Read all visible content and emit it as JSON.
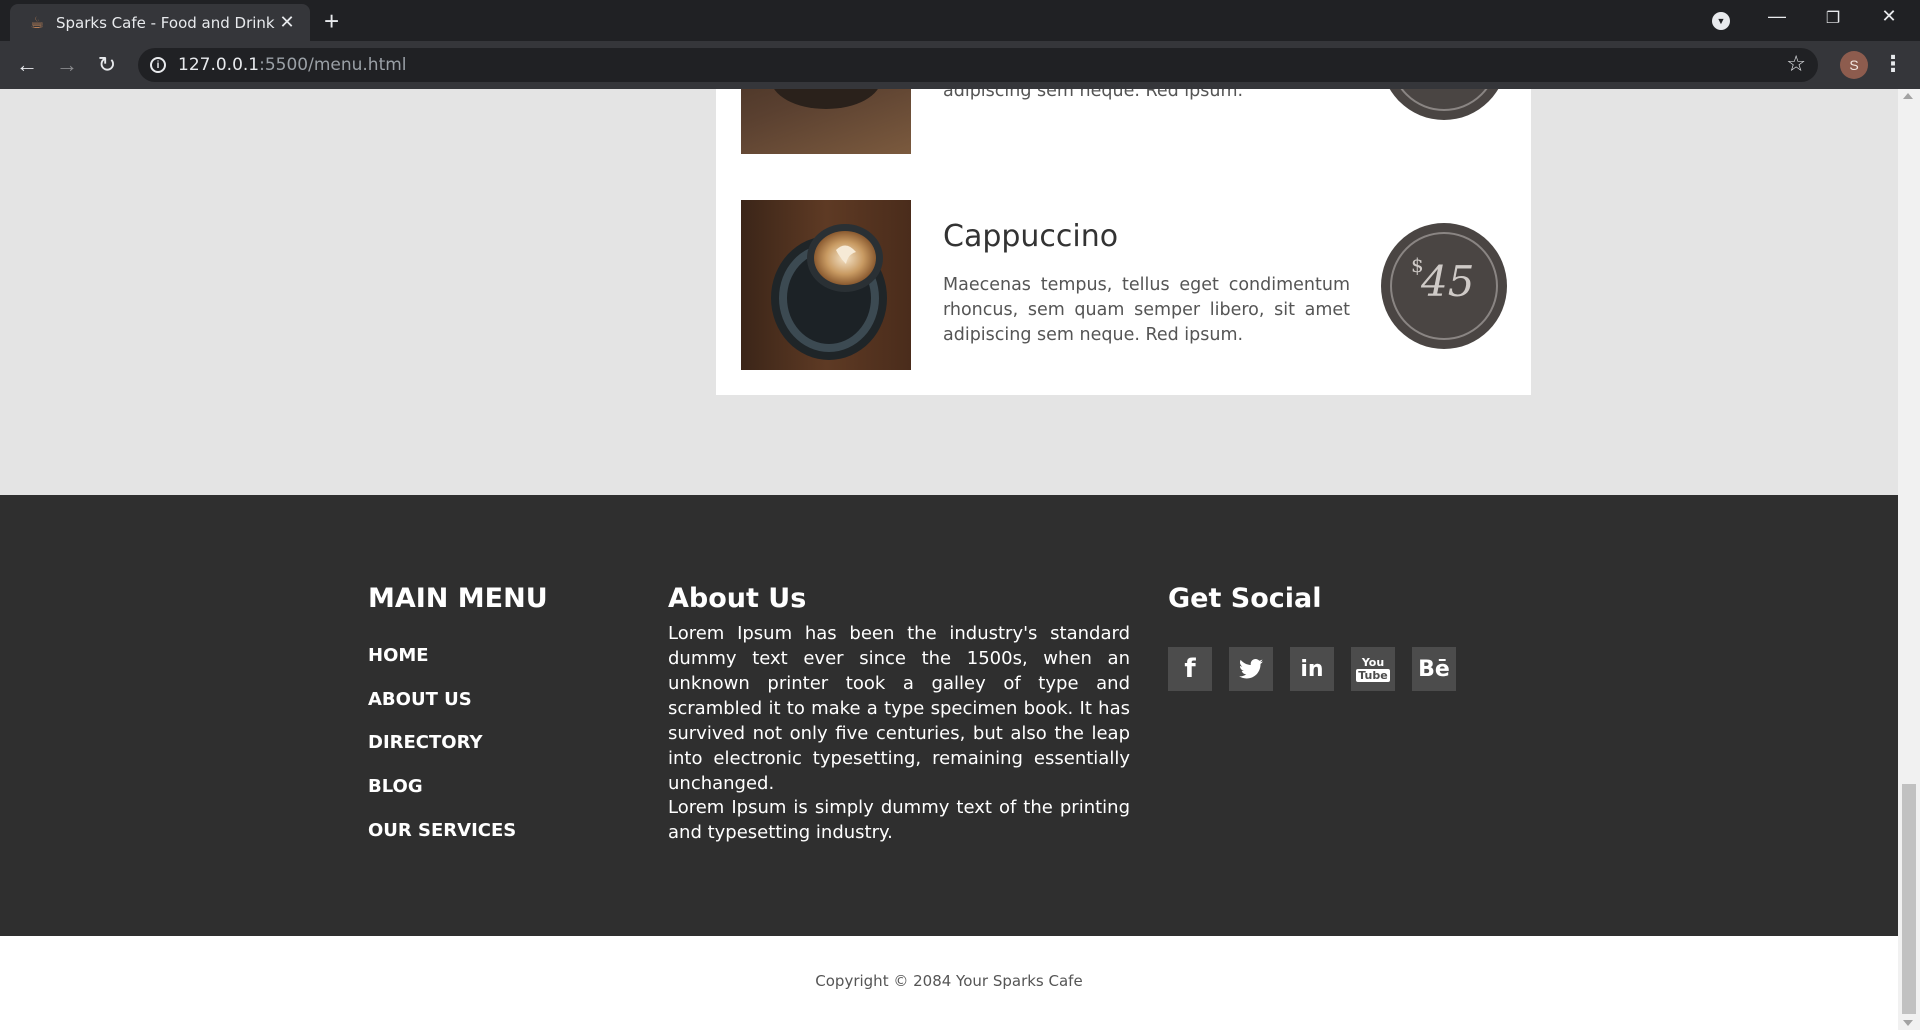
{
  "browser": {
    "tab_title": "Sparks Cafe - Food and Drink Me",
    "url_host": "127.0.0.1",
    "url_path": ":5500/menu.html",
    "profile_initial": "S"
  },
  "menu_items": [
    {
      "desc_tail": "adipiscing sem neque. Red ipsum."
    },
    {
      "name": "Cappuccino",
      "description": "Maecenas tempus, tellus eget condimentum rhoncus, sem quam semper libero, sit amet adipiscing sem neque. Red ipsum.",
      "currency": "$",
      "price": "45"
    }
  ],
  "footer": {
    "main_menu": {
      "heading": "MAIN MENU",
      "links": [
        "HOME",
        "ABOUT US",
        "DIRECTORY",
        "BLOG",
        "OUR SERVICES"
      ]
    },
    "about": {
      "heading": "About Us",
      "paragraphs": [
        "Lorem Ipsum has been the industry's standard dummy text ever since the 1500s, when an unknown printer took a galley of type and scrambled it to make a type specimen book. It has survived not only five centuries, but also the leap into electronic typesetting, remaining essentially unchanged.",
        "Lorem Ipsum is simply dummy text of the printing and typesetting industry."
      ]
    },
    "social": {
      "heading": "Get Social",
      "icons": [
        "facebook-icon",
        "twitter-icon",
        "linkedin-icon",
        "youtube-icon",
        "behance-icon"
      ]
    },
    "copyright": "Copyright © 2084 Your Sparks Cafe"
  },
  "colors": {
    "page_bg": "#e4e4e4",
    "footer_bg": "#2f2f2f",
    "price_badge": "#4a4543"
  }
}
